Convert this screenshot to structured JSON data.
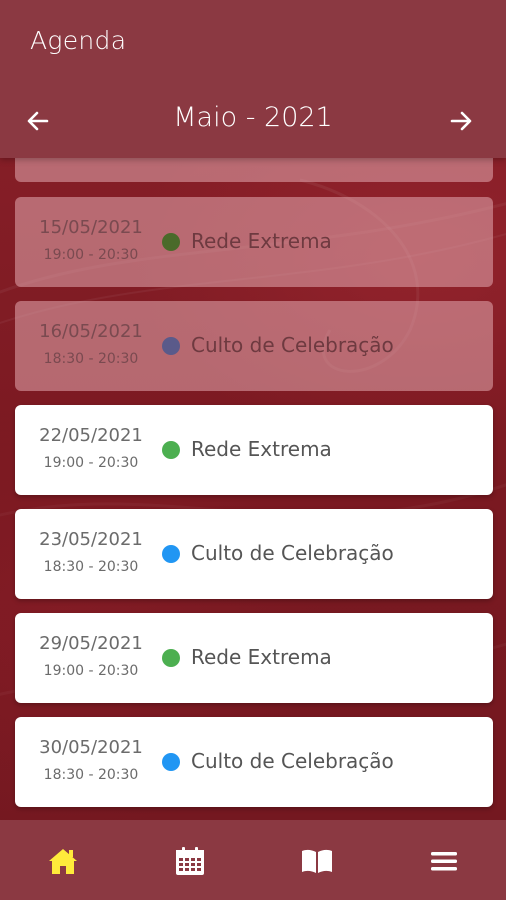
{
  "header": {
    "title": "Agenda",
    "month_label": "Maio - 2021",
    "prev_icon": "arrow-left-icon",
    "next_icon": "arrow-right-icon"
  },
  "events": [
    {
      "date": "15/05/2021",
      "time": "19:00 - 20:30",
      "title": "Rede Extrema",
      "color": "#4caf50",
      "past": true
    },
    {
      "date": "16/05/2021",
      "time": "18:30 - 20:30",
      "title": "Culto de Celebração",
      "color": "#2196f3",
      "past": true
    },
    {
      "date": "22/05/2021",
      "time": "19:00 - 20:30",
      "title": "Rede Extrema",
      "color": "#4caf50",
      "past": false
    },
    {
      "date": "23/05/2021",
      "time": "18:30 - 20:30",
      "title": "Culto de Celebração",
      "color": "#2196f3",
      "past": false
    },
    {
      "date": "29/05/2021",
      "time": "19:00 - 20:30",
      "title": "Rede Extrema",
      "color": "#4caf50",
      "past": false
    },
    {
      "date": "30/05/2021",
      "time": "18:30 - 20:30",
      "title": "Culto de Celebração",
      "color": "#2196f3",
      "past": false
    }
  ],
  "bottom_nav": {
    "items": [
      {
        "icon": "home-icon",
        "active": true
      },
      {
        "icon": "calendar-icon",
        "active": false
      },
      {
        "icon": "book-icon",
        "active": false
      },
      {
        "icon": "menu-icon",
        "active": false
      }
    ],
    "active_color": "#ffeb3b",
    "inactive_color": "#ffffff"
  },
  "colors": {
    "header_bg": "#8b3942",
    "background": "#7d1a22"
  }
}
